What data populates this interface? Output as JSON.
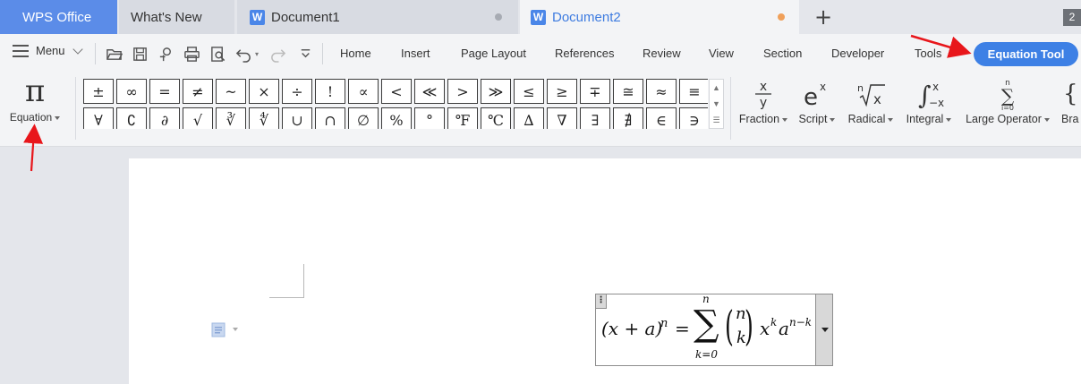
{
  "tabs": [
    {
      "label": "WPS Office"
    },
    {
      "label": "What's New"
    },
    {
      "label": "Document1"
    },
    {
      "label": "Document2"
    }
  ],
  "tab_icon_letter": "W",
  "window_count": "2",
  "menu": {
    "label": "Menu",
    "items": [
      "Home",
      "Insert",
      "Page Layout",
      "References",
      "Review",
      "View",
      "Section",
      "Developer",
      "Tools"
    ],
    "active_tool": "Equation Tool"
  },
  "ribbon": {
    "equation_label": "Equation",
    "equation_glyph": "π",
    "symbols": [
      "±",
      "∞",
      "=",
      "≠",
      "~",
      "×",
      "÷",
      "!",
      "∝",
      "<",
      "≪",
      ">",
      "≫",
      "≤",
      "≥",
      "∓",
      "≅",
      "≈",
      "≡",
      "∀",
      "∁",
      "∂",
      "√",
      "∛",
      "∜",
      "∪",
      "∩",
      "∅",
      "%",
      "°",
      "℉",
      "℃",
      "∆",
      "∇",
      "∃",
      "∄",
      "∈",
      "∋",
      "←",
      "↑"
    ],
    "tools": [
      {
        "label": "Fraction",
        "glyph": "x/y"
      },
      {
        "label": "Script",
        "glyph": "eˣ"
      },
      {
        "label": "Radical",
        "glyph": "ⁿ√x"
      },
      {
        "label": "Integral",
        "glyph": "∫"
      },
      {
        "label": "Large Operator",
        "glyph": "∑"
      },
      {
        "label": "Bra",
        "glyph": "{"
      }
    ]
  },
  "equation": {
    "lhs": "(x + a)",
    "lhs_exp": "n",
    "equals": "=",
    "sum_symbol": "∑",
    "sum_upper": "n",
    "sum_lower": "k=0",
    "binom_top": "n",
    "binom_bottom": "k",
    "term_x": "x",
    "term_x_exp": "k",
    "term_a": "a",
    "term_a_exp": "n−k"
  },
  "colors": {
    "accent": "#3d80e5",
    "wps_tab": "#5b8ce8",
    "annotation_arrow": "#e8161b"
  }
}
